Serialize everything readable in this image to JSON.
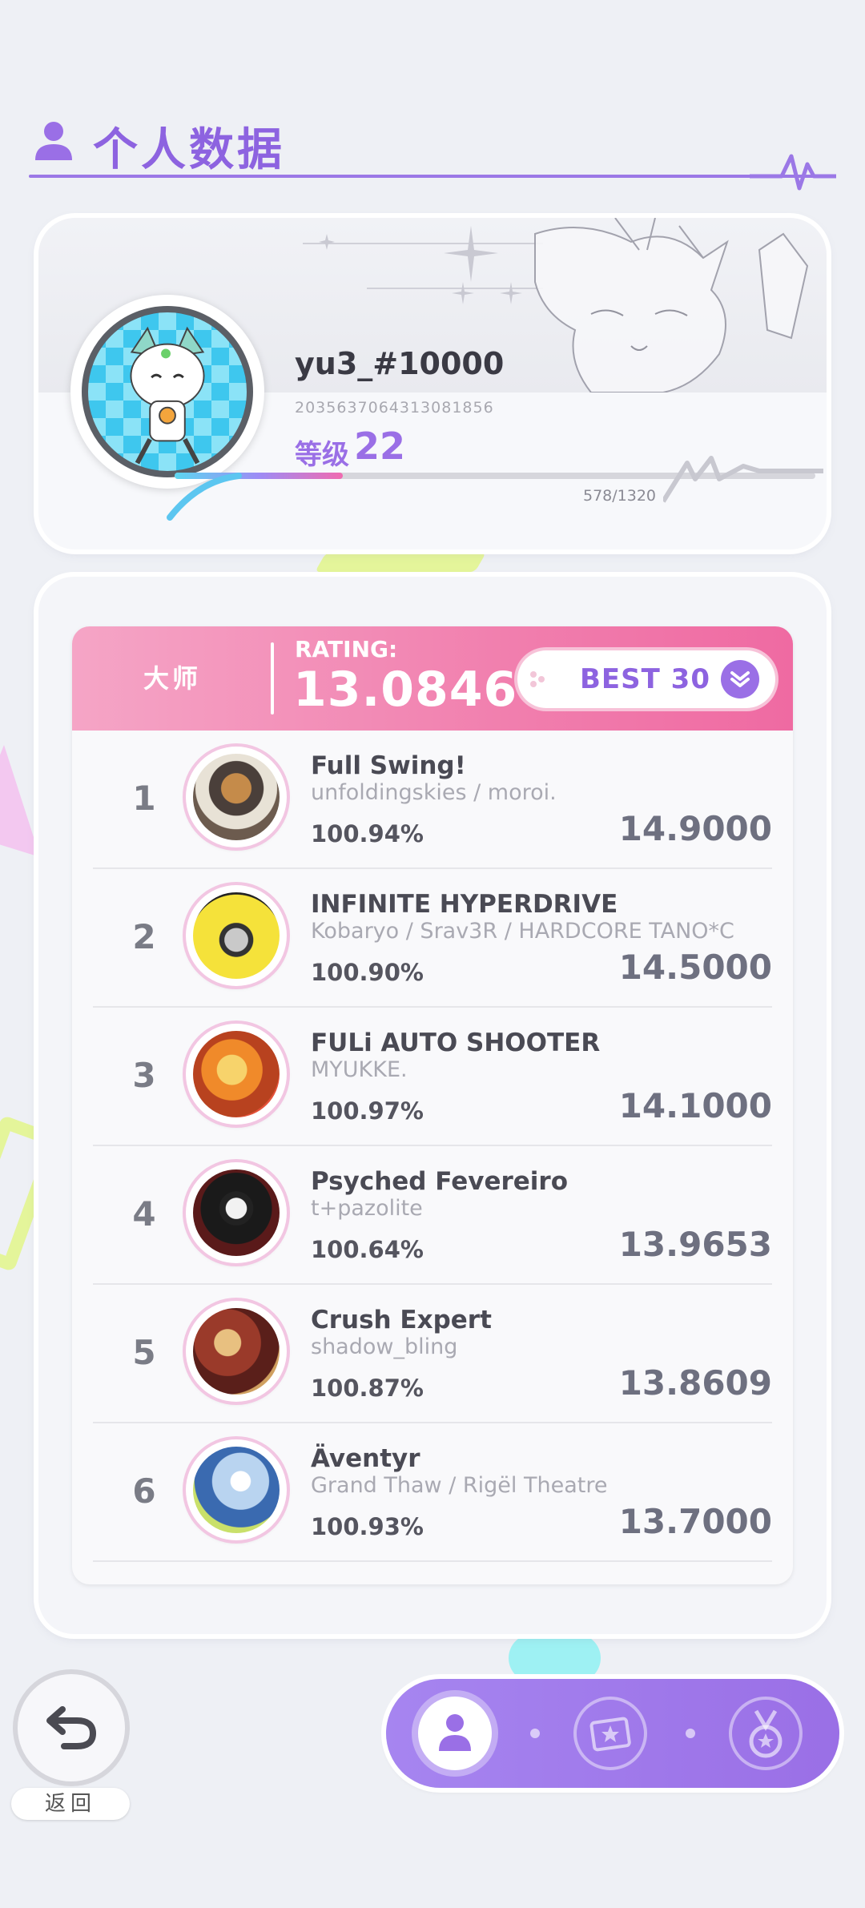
{
  "header": {
    "title": "个人数据"
  },
  "profile": {
    "username": "yu3_#10000",
    "user_id": "2035637064313081856",
    "level_label": "等级",
    "level": "22",
    "xp_text": "578/1320",
    "xp_fraction": 0.438
  },
  "rating": {
    "difficulty": "大师",
    "label": "RATING:",
    "value": "13.0846",
    "best_button": "BEST 30"
  },
  "songs": [
    {
      "rank": "1",
      "title": "Full Swing!",
      "artist": "unfoldingskies / moroi.",
      "accuracy": "100.94%",
      "rating": "14.9000"
    },
    {
      "rank": "2",
      "title": "INFINITE HYPERDRIVE",
      "artist": "Kobaryo / Srav3R / HARDCORE TANO*C",
      "accuracy": "100.90%",
      "rating": "14.5000"
    },
    {
      "rank": "3",
      "title": "FULi AUTO SHOOTER",
      "artist": "MYUKKE.",
      "accuracy": "100.97%",
      "rating": "14.1000"
    },
    {
      "rank": "4",
      "title": "Psyched Fevereiro",
      "artist": "t+pazolite",
      "accuracy": "100.64%",
      "rating": "13.9653"
    },
    {
      "rank": "5",
      "title": "Crush Expert",
      "artist": "shadow_bling",
      "accuracy": "100.87%",
      "rating": "13.8609"
    },
    {
      "rank": "6",
      "title": "Äventyr",
      "artist": "Grand Thaw / Rigël Theatre",
      "accuracy": "100.93%",
      "rating": "13.7000"
    }
  ],
  "bottom": {
    "back_label": "返回"
  },
  "colors": {
    "accent": "#9a6fe6",
    "pink": "#f17fae"
  }
}
